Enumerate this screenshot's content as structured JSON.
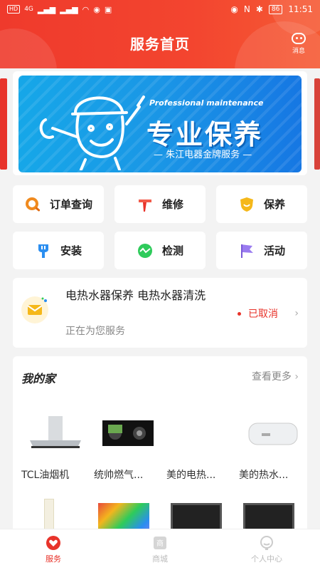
{
  "status_bar": {
    "time": "11:51",
    "battery": "86",
    "network": "4G"
  },
  "header": {
    "title": "服务首页",
    "message_label": "消息"
  },
  "banner": {
    "tagline": "Professional maintenance",
    "headline": "专业保养",
    "subline": "— 朱江电器金牌服务 —"
  },
  "services": [
    {
      "label": "订单查询",
      "icon": "order-search-icon",
      "color": "#f08a1e"
    },
    {
      "label": "维修",
      "icon": "hammer-icon",
      "color": "#e8332a"
    },
    {
      "label": "保养",
      "icon": "shield-icon",
      "color": "#f5b81a"
    },
    {
      "label": "安装",
      "icon": "install-icon",
      "color": "#2b8ef0"
    },
    {
      "label": "检测",
      "icon": "detect-icon",
      "color": "#2ecb5b"
    },
    {
      "label": "活动",
      "icon": "flag-icon",
      "color": "#9a7bf0"
    }
  ],
  "order": {
    "title": "电热水器保养 电热水器清洗",
    "subtitle": "正在为您服务",
    "status": "已取消"
  },
  "home": {
    "title": "我的家",
    "more": "查看更多",
    "products": [
      {
        "name": "TCL油烟机"
      },
      {
        "name": "统帅燃气..."
      },
      {
        "name": "美的电热..."
      },
      {
        "name": "美的热水..."
      }
    ]
  },
  "nav": [
    {
      "label": "服务"
    },
    {
      "label": "商城"
    },
    {
      "label": "个人中心"
    }
  ],
  "colors": {
    "brand": "#ef3a2c",
    "banner": "#1a96e6"
  }
}
